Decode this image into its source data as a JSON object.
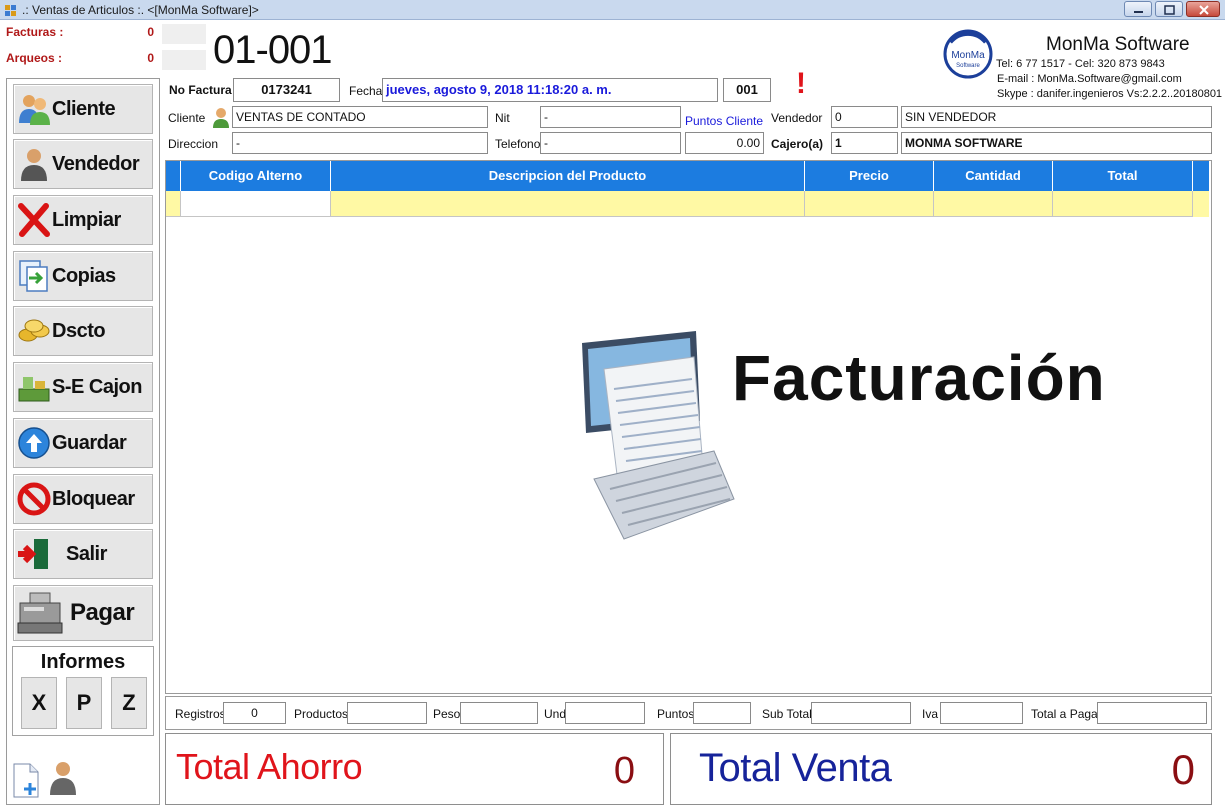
{
  "window": {
    "title": ".: Ventas de Articulos :.  <[MonMa Software]>"
  },
  "counters": [
    {
      "label": "Facturas :",
      "value": "0"
    },
    {
      "label": "Arqueos :",
      "value": "0"
    }
  ],
  "store_code": "01-001",
  "brand": {
    "logo_text": "MonMa",
    "logo_subtext": "Software",
    "name": "MonMa Software",
    "lines": [
      "Tel: 6 77 1517 - Cel: 320 873 9843",
      "E-mail : MonMa.Software@gmail.com",
      "Skype : danifer.ingenieros   Vs:2.2.2..20180801"
    ]
  },
  "invoice": {
    "no_factura_label": "No Factura",
    "no_factura": "0173241",
    "fecha_label": "Fecha",
    "fecha": "jueves, agosto 9, 2018 11:18:20 a. m.",
    "caja": "001",
    "alert_mark": "!",
    "cliente_label": "Cliente",
    "cliente": "VENTAS DE CONTADO",
    "nit_label": "Nit",
    "nit": "-",
    "puntos_cliente_label": "Puntos Cliente",
    "vendedor_label": "Vendedor",
    "vendedor_code": "0",
    "vendedor_name": "SIN VENDEDOR",
    "direccion_label": "Direccion",
    "direccion": "-",
    "telefono_label": "Telefono",
    "telefono": "-",
    "puntos_value": "0.00",
    "cajero_label": "Cajero(a)",
    "cajero_code": "1",
    "cajero_name": "MONMA SOFTWARE"
  },
  "sidebar": {
    "buttons": [
      {
        "label": "Cliente",
        "icon": "users-icon"
      },
      {
        "label": "Vendedor",
        "icon": "person-icon"
      },
      {
        "label": "Limpiar",
        "icon": "red-x-icon"
      },
      {
        "label": "Copias",
        "icon": "copies-icon"
      },
      {
        "label": "Dscto",
        "icon": "coins-icon"
      },
      {
        "label": "S-E Cajon",
        "icon": "money-drawer-icon"
      },
      {
        "label": "Guardar",
        "icon": "up-arrow-icon"
      },
      {
        "label": "Bloquear",
        "icon": "block-icon"
      },
      {
        "label": "Salir",
        "icon": "exit-door-icon"
      },
      {
        "label": "Pagar",
        "icon": "cash-register-icon"
      }
    ],
    "informes": {
      "title": "Informes",
      "buttons": [
        "X",
        "P",
        "Z"
      ]
    },
    "bottom_icons": [
      "new-document-icon",
      "user-icon"
    ]
  },
  "grid": {
    "columns": [
      "Codigo Alterno",
      "Descripcion del Producto",
      "Precio",
      "Cantidad",
      "Total"
    ]
  },
  "watermark": {
    "text": "Facturación",
    "icon": "invoice-computer-icon"
  },
  "summary": {
    "registros_label": "Registros",
    "registros": "0",
    "productos_label": "Productos",
    "productos": "",
    "peso_label": "Peso",
    "peso": "",
    "und_label": "Und",
    "und": "",
    "puntos_label": "Puntos",
    "puntos": "",
    "subtotal_label": "Sub Total",
    "subtotal": "",
    "iva_label": "Iva",
    "iva": "",
    "total_pagar_label": "Total a Pagar",
    "total_pagar": ""
  },
  "totals": {
    "ahorro_label": "Total Ahorro",
    "ahorro": "0",
    "venta_label": "Total Venta",
    "venta": "0"
  },
  "colors": {
    "grid_header": "#1c7ce0",
    "grid_edit_row": "#fff9a4",
    "ahorro": "#e0141b",
    "venta": "#16239a",
    "counter": "#b01818",
    "fecha_text": "#1a1adb"
  }
}
